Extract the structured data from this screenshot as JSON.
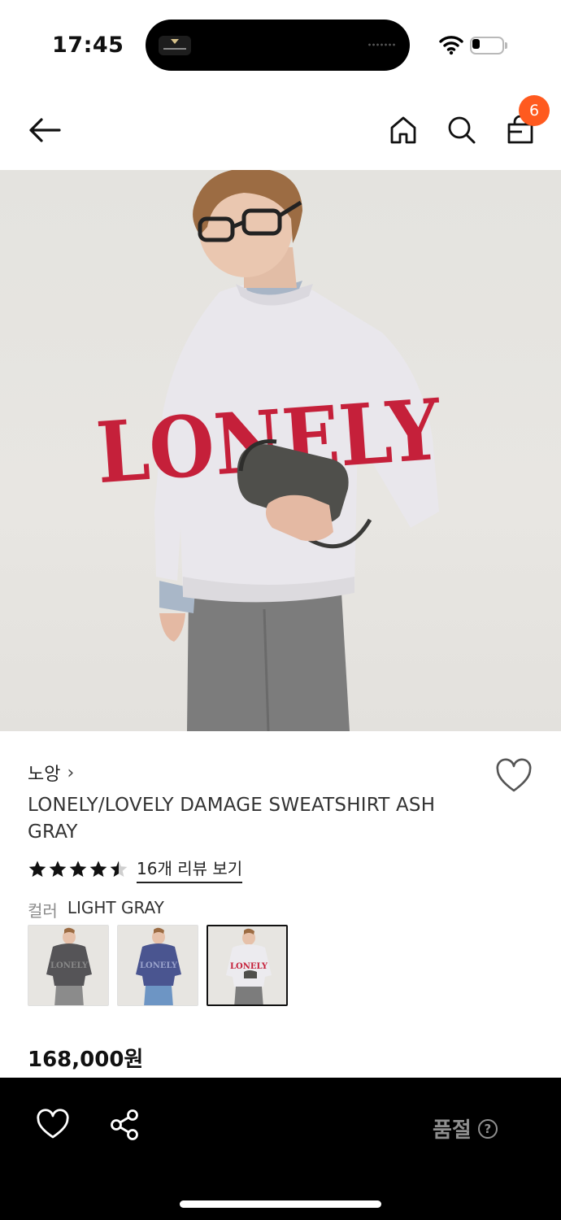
{
  "status_bar": {
    "time": "17:45",
    "battery_level": 0.25,
    "icons": [
      "wifi-icon",
      "battery-icon"
    ]
  },
  "header": {
    "icons": [
      "back-arrow-icon",
      "home-icon",
      "search-icon",
      "shopping-bag-icon"
    ],
    "cart_count": "6",
    "badge_color": "#ff5a1f"
  },
  "product": {
    "image_text": "LONELY",
    "brand": "노앙",
    "title": "LONELY/LOVELY DAMAGE SWEATSHIRT ASH GRAY",
    "rating": 4.5,
    "reviews_link": "16개 리뷰 보기",
    "color_label": "컬러",
    "color_value": "LIGHT GRAY",
    "swatch_texts": [
      "LONELY",
      "LONELY",
      "LONELY"
    ],
    "price": "168,000원"
  },
  "bottom_bar": {
    "icons": [
      "heart-icon",
      "share-icon",
      "help-icon"
    ],
    "soldout_label": "품절",
    "help_symbol": "?",
    "disabled_color": "#8f8f8f"
  }
}
